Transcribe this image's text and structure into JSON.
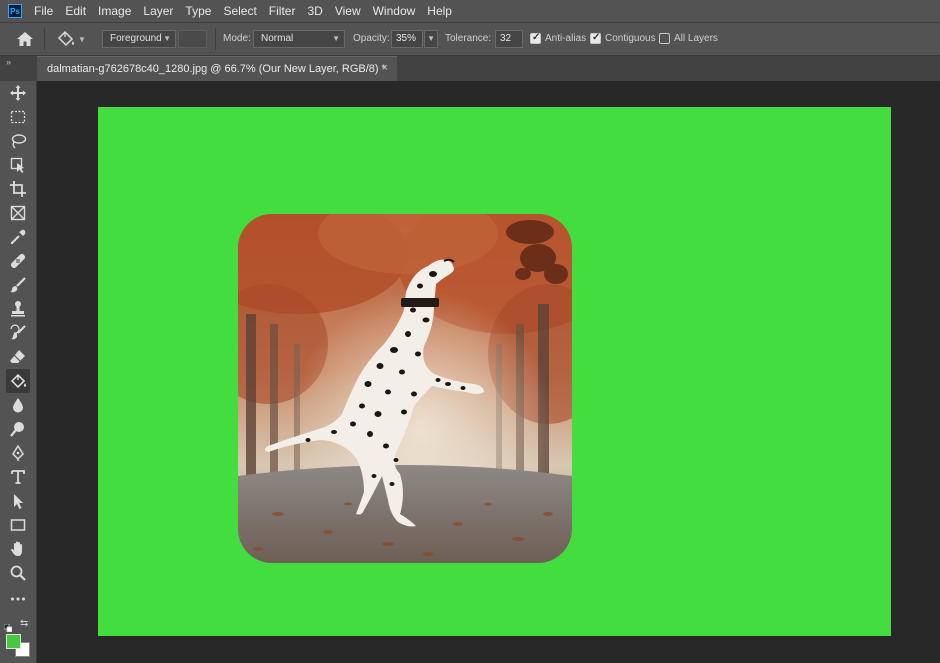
{
  "app": {
    "logo_text": "Ps"
  },
  "menu": [
    "File",
    "Edit",
    "Image",
    "Layer",
    "Type",
    "Select",
    "Filter",
    "3D",
    "View",
    "Window",
    "Help"
  ],
  "options": {
    "fill_source": "Foreground",
    "mode_label": "Mode:",
    "mode_value": "Normal",
    "opacity_label": "Opacity:",
    "opacity_value": "35%",
    "tolerance_label": "Tolerance:",
    "tolerance_value": "32",
    "anti_alias_label": "Anti-alias",
    "anti_alias_checked": true,
    "contiguous_label": "Contiguous",
    "contiguous_checked": true,
    "all_layers_label": "All Layers",
    "all_layers_checked": false
  },
  "panel_toggle": "»",
  "document": {
    "tab_title": "dalmatian-g762678c40_1280.jpg @ 66.7% (Our New Layer, RGB/8) *",
    "close_glyph": "×",
    "canvas_color": "#44dd3f"
  },
  "tools": [
    {
      "name": "move-tool",
      "active": false
    },
    {
      "name": "marquee-tool",
      "active": false
    },
    {
      "name": "lasso-tool",
      "active": false
    },
    {
      "name": "object-selection-tool",
      "active": false
    },
    {
      "name": "crop-tool",
      "active": false
    },
    {
      "name": "frame-tool",
      "active": false
    },
    {
      "name": "eyedropper-tool",
      "active": false
    },
    {
      "name": "healing-brush-tool",
      "active": false
    },
    {
      "name": "brush-tool",
      "active": false
    },
    {
      "name": "stamp-tool",
      "active": false
    },
    {
      "name": "history-brush-tool",
      "active": false
    },
    {
      "name": "eraser-tool",
      "active": false
    },
    {
      "name": "paint-bucket-tool",
      "active": true
    },
    {
      "name": "blur-tool",
      "active": false
    },
    {
      "name": "dodge-tool",
      "active": false
    },
    {
      "name": "pen-tool",
      "active": false
    },
    {
      "name": "type-tool",
      "active": false
    },
    {
      "name": "path-selection-tool",
      "active": false
    },
    {
      "name": "rectangle-tool",
      "active": false
    },
    {
      "name": "hand-tool",
      "active": false
    },
    {
      "name": "zoom-tool",
      "active": false
    },
    {
      "name": "more-tools",
      "active": false
    }
  ],
  "colors": {
    "foreground": "#44c93f",
    "background": "#ffffff"
  }
}
